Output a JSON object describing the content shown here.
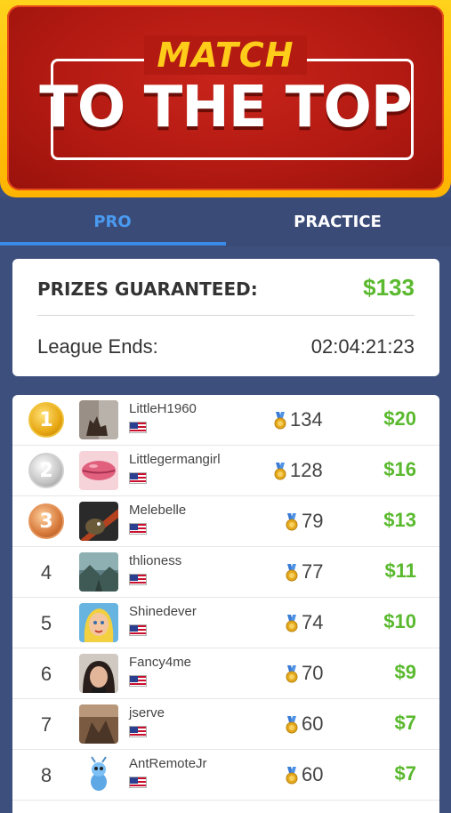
{
  "header": {
    "subtitle": "MATCH",
    "title": "TO THE TOP"
  },
  "tabs": [
    {
      "label": "PRO",
      "active": true
    },
    {
      "label": "PRACTICE",
      "active": false
    }
  ],
  "summary": {
    "prizes_label": "PRIZES GUARANTEED:",
    "prizes_value": "$133",
    "league_label": "League Ends:",
    "league_value": "02:04:21:23"
  },
  "colors": {
    "accent_blue": "#3b8be8",
    "prize_green": "#5ab92e",
    "banner_red": "#b31a12",
    "banner_yellow": "#ffcc1a"
  },
  "leaderboard": [
    {
      "rank": "1",
      "medal": "gold",
      "name": "LittleH1960",
      "points": "134",
      "prize": "$20",
      "avatar": "cat-silhouette"
    },
    {
      "rank": "2",
      "medal": "silver",
      "name": "Littlegermangirl",
      "points": "128",
      "prize": "$16",
      "avatar": "lips"
    },
    {
      "rank": "3",
      "medal": "bronze",
      "name": "Melebelle",
      "points": "79",
      "prize": "$13",
      "avatar": "bird"
    },
    {
      "rank": "4",
      "medal": "none",
      "name": "thlioness",
      "points": "77",
      "prize": "$11",
      "avatar": "landscape"
    },
    {
      "rank": "5",
      "medal": "none",
      "name": "Shinedever",
      "points": "74",
      "prize": "$10",
      "avatar": "cartoon-woman"
    },
    {
      "rank": "6",
      "medal": "none",
      "name": "Fancy4me",
      "points": "70",
      "prize": "$9",
      "avatar": "woman-photo"
    },
    {
      "rank": "7",
      "medal": "none",
      "name": "jserve",
      "points": "60",
      "prize": "$7",
      "avatar": "brown-photo"
    },
    {
      "rank": "8",
      "medal": "none",
      "name": "AntRemoteJr",
      "points": "60",
      "prize": "$7",
      "avatar": "blue-bug"
    }
  ]
}
